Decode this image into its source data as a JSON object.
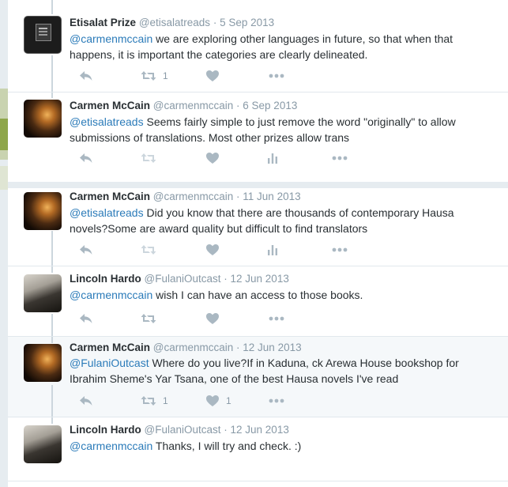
{
  "tweets": [
    {
      "name": "Etisalat Prize",
      "handle": "@etisalatreads",
      "date": "5 Sep 2013",
      "mention": "@carmenmccain",
      "text": " we are exploring other languages in future, so that when that happens, it is important the categories are clearly delineated.",
      "retweets": "1",
      "likes": ""
    },
    {
      "name": "Carmen McCain",
      "handle": "@carmenmccain",
      "date": "6 Sep 2013",
      "mention": "@etisalatreads",
      "text": " Seems fairly simple to just remove the word \"originally\" to allow submissions of translations. Most other prizes allow trans",
      "retweets": "",
      "likes": ""
    },
    {
      "name": "Carmen McCain",
      "handle": "@carmenmccain",
      "date": "11 Jun 2013",
      "mention": "@etisalatreads",
      "text": " Did you know that there are thousands of contemporary Hausa novels?Some are award quality but difficult to find translators",
      "retweets": "",
      "likes": ""
    },
    {
      "name": "Lincoln Hardo",
      "handle": "@FulaniOutcast",
      "date": "12 Jun 2013",
      "mention": "@carmenmccain",
      "text": " wish I can have an access to those books.",
      "retweets": "",
      "likes": ""
    },
    {
      "name": "Carmen McCain",
      "handle": "@carmenmccain",
      "date": "12 Jun 2013",
      "mention": "@FulaniOutcast",
      "text": " Where do you live?If in Kaduna, ck Arewa House bookshop for Ibrahim Sheme's Yar Tsana, one of the best Hausa novels I've read",
      "retweets": "1",
      "likes": "1"
    },
    {
      "name": "Lincoln Hardo",
      "handle": "@FulaniOutcast",
      "date": "12 Jun 2013",
      "mention": "@carmenmccain",
      "text": " Thanks, I will try and check. :)",
      "retweets": "",
      "likes": ""
    }
  ],
  "separator": " · ",
  "icons": {
    "reply": "reply-icon",
    "retweet": "retweet-icon",
    "like": "heart-icon",
    "analytics": "analytics-icon",
    "more": "more-icon"
  },
  "colors": {
    "link": "#2b7bb9",
    "meta": "#8899a6",
    "icon": "#aab8c2",
    "highlight": "#f5f8fa"
  }
}
